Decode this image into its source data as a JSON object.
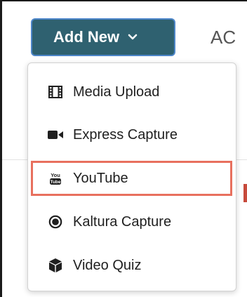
{
  "toolbar": {
    "add_new_label": "Add New",
    "partial_tab_label": "AC"
  },
  "menu": {
    "items": [
      {
        "label": "Media Upload",
        "icon": "film-icon"
      },
      {
        "label": "Express Capture",
        "icon": "video-camera-icon"
      },
      {
        "label": "YouTube",
        "icon": "youtube-icon",
        "highlighted": true
      },
      {
        "label": "Kaltura Capture",
        "icon": "record-icon"
      },
      {
        "label": "Video Quiz",
        "icon": "cube-icon"
      }
    ]
  },
  "colors": {
    "button_bg": "#2f6170",
    "button_border": "#4d86c9",
    "highlight_border": "#e8705e",
    "menu_text": "#1f1f1f"
  }
}
